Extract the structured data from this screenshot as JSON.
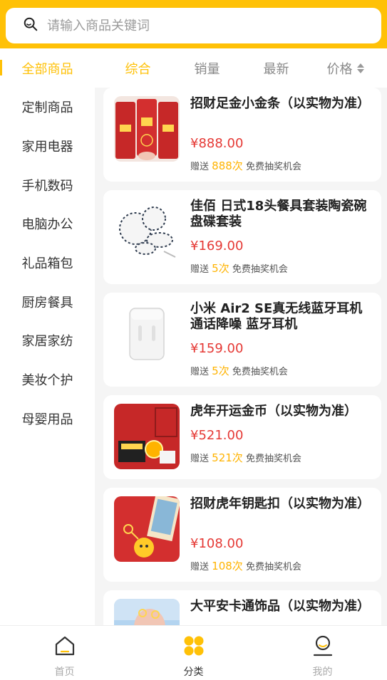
{
  "search": {
    "placeholder": "请输入商品关键词",
    "icon": "search-icon"
  },
  "topbar": {
    "all_label": "全部商品",
    "sort_tabs": [
      {
        "label": "综合",
        "active": true
      },
      {
        "label": "销量",
        "active": false
      },
      {
        "label": "最新",
        "active": false
      },
      {
        "label": "价格",
        "active": false,
        "icon": "sort-arrows-icon"
      }
    ]
  },
  "sidebar": {
    "items": [
      "定制商品",
      "家用电器",
      "手机数码",
      "电脑办公",
      "礼品箱包",
      "厨房餐具",
      "家居家纺",
      "美妆个护",
      "母婴用品"
    ]
  },
  "products": [
    {
      "name": "招财足金小金条（以实物为准）",
      "price": "¥888.00",
      "gift_prefix": "赠送",
      "gift_count": "888次",
      "gift_suffix": "免费抽奖机会"
    },
    {
      "name": "佳佰 日式18头餐具套装陶瓷碗盘碟套装",
      "price": "¥169.00",
      "gift_prefix": "赠送",
      "gift_count": "5次",
      "gift_suffix": "免费抽奖机会"
    },
    {
      "name": "小米 Air2 SE真无线蓝牙耳机 通话降噪 蓝牙耳机",
      "price": "¥159.00",
      "gift_prefix": "赠送",
      "gift_count": "5次",
      "gift_suffix": "免费抽奖机会"
    },
    {
      "name": "虎年开运金币（以实物为准）",
      "price": "¥521.00",
      "gift_prefix": "赠送",
      "gift_count": "521次",
      "gift_suffix": "免费抽奖机会"
    },
    {
      "name": "招财虎年钥匙扣（以实物为准）",
      "price": "¥108.00",
      "gift_prefix": "赠送",
      "gift_count": "108次",
      "gift_suffix": "免费抽奖机会"
    },
    {
      "name": "大平安卡通饰品（以实物为准）"
    }
  ],
  "bottom_nav": [
    {
      "label": "首页",
      "icon": "home-icon",
      "active": false
    },
    {
      "label": "分类",
      "icon": "category-icon",
      "active": true
    },
    {
      "label": "我的",
      "icon": "profile-icon",
      "active": false
    }
  ],
  "colors": {
    "accent": "#ffc107",
    "price": "#e53935",
    "gift_count": "#ffb300"
  }
}
